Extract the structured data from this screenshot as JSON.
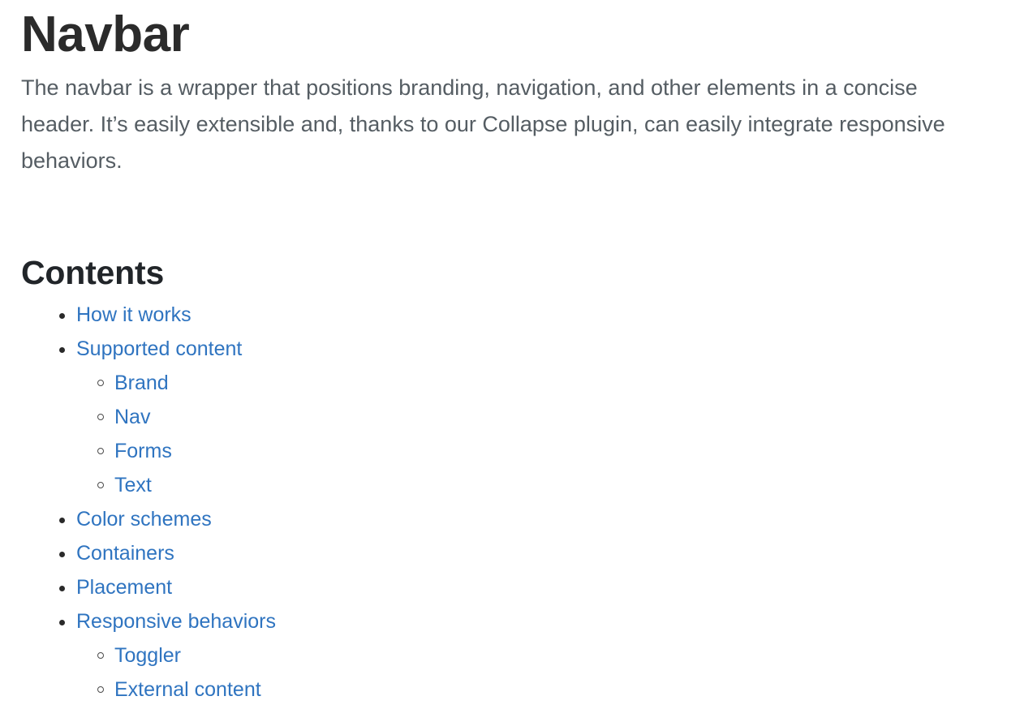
{
  "page": {
    "title": "Navbar",
    "intro": "The navbar is a wrapper that positions branding, navigation, and other elements in a concise header. It’s easily extensible and, thanks to our Collapse plugin, can easily integrate responsive behaviors.",
    "contents_heading": "Contents"
  },
  "colors": {
    "link": "#2f74c0",
    "heading": "#212529",
    "body_text": "#555d63",
    "marker": "#2a2a2a",
    "background": "#ffffff"
  },
  "toc": {
    "items": [
      {
        "label": "How it works",
        "children": []
      },
      {
        "label": "Supported content",
        "children": [
          {
            "label": "Brand"
          },
          {
            "label": "Nav"
          },
          {
            "label": "Forms"
          },
          {
            "label": "Text"
          }
        ]
      },
      {
        "label": "Color schemes",
        "children": []
      },
      {
        "label": "Containers",
        "children": []
      },
      {
        "label": "Placement",
        "children": []
      },
      {
        "label": "Responsive behaviors",
        "children": [
          {
            "label": "Toggler"
          },
          {
            "label": "External content"
          }
        ]
      }
    ]
  }
}
